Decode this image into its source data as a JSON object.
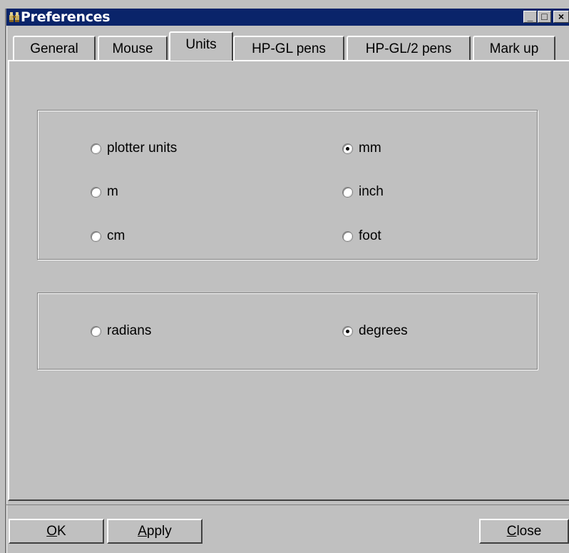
{
  "window": {
    "title": "Preferences",
    "minimize_glyph": "_",
    "maximize_glyph": "□",
    "close_glyph": "×"
  },
  "tabs": [
    {
      "label": "General",
      "active": false
    },
    {
      "label": "Mouse",
      "active": false
    },
    {
      "label": "Units",
      "active": true
    },
    {
      "label": "HP-GL pens",
      "active": false
    },
    {
      "label": "HP-GL/2 pens",
      "active": false
    },
    {
      "label": "Mark up",
      "active": false
    }
  ],
  "length_units": {
    "options": [
      {
        "label": "plotter units",
        "checked": false
      },
      {
        "label": "mm",
        "checked": true
      },
      {
        "label": "m",
        "checked": false
      },
      {
        "label": "inch",
        "checked": false
      },
      {
        "label": "cm",
        "checked": false
      },
      {
        "label": "foot",
        "checked": false
      }
    ]
  },
  "angle_units": {
    "options": [
      {
        "label": "radians",
        "checked": false
      },
      {
        "label": "degrees",
        "checked": true
      }
    ]
  },
  "buttons": {
    "ok_mnemonic": "O",
    "ok_rest": "K",
    "apply_mnemonic": "A",
    "apply_rest": "pply",
    "close_mnemonic": "C",
    "close_rest": "lose"
  },
  "colors": {
    "titlebar": "#0a246a",
    "face": "#c0c0c0"
  },
  "icons": {
    "app": "binoculars-icon"
  }
}
